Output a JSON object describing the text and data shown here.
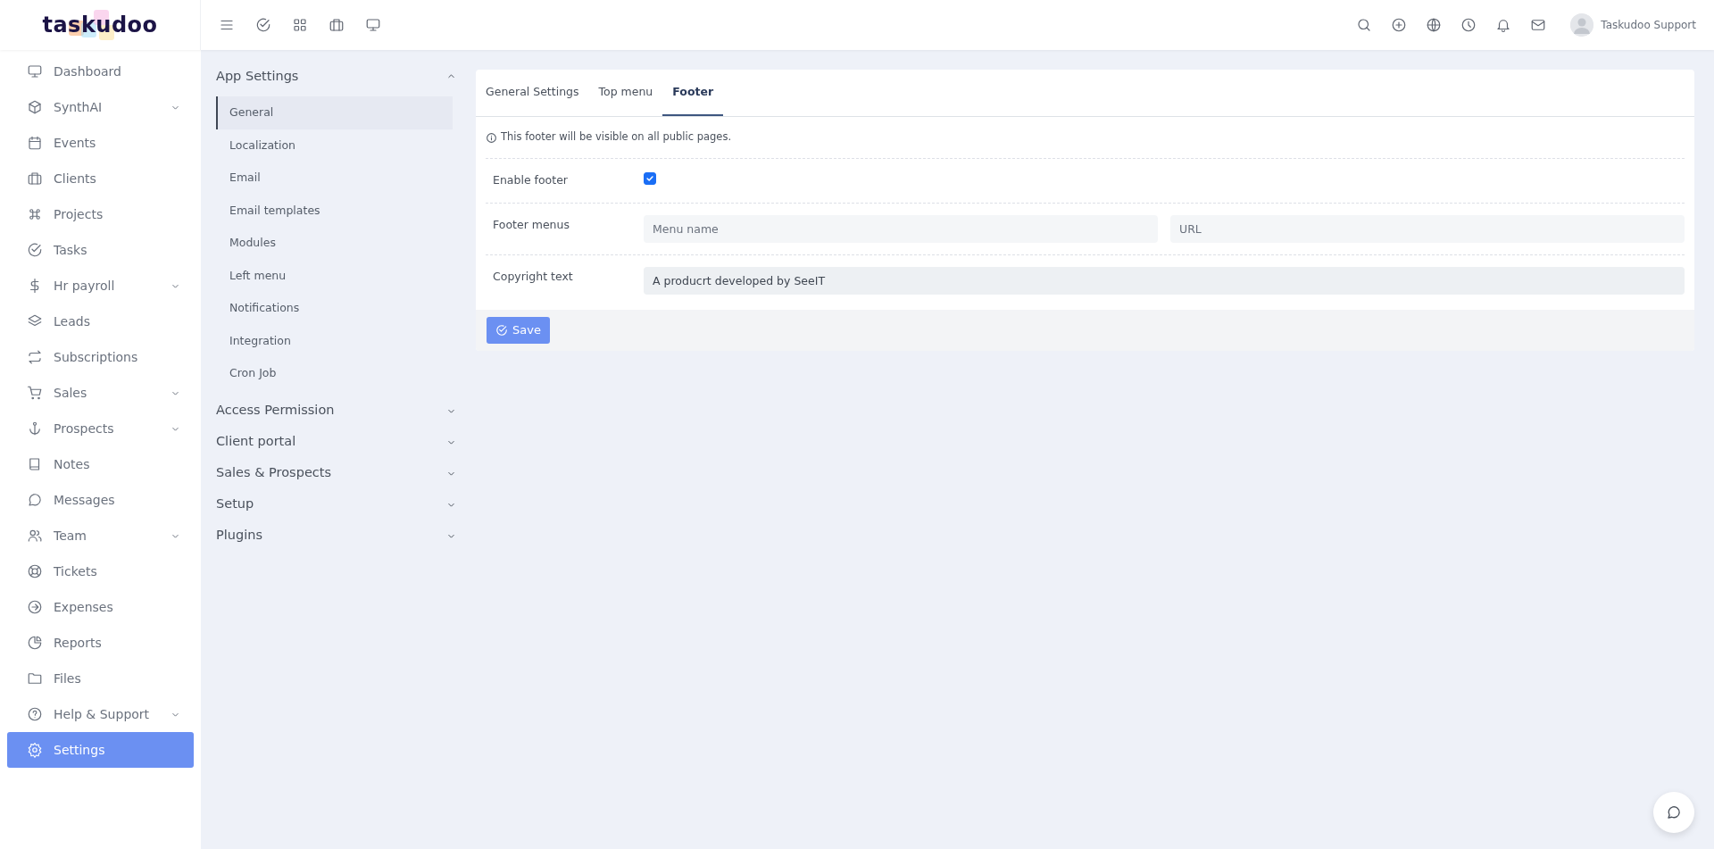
{
  "logo": {
    "text": "taskudoo"
  },
  "topbar": {
    "user": "Taskudoo Support"
  },
  "sidebar": {
    "items": [
      {
        "label": "Dashboard",
        "expandable": false,
        "selected": false
      },
      {
        "label": "SynthAI",
        "expandable": true,
        "selected": false
      },
      {
        "label": "Events",
        "expandable": false,
        "selected": false
      },
      {
        "label": "Clients",
        "expandable": false,
        "selected": false
      },
      {
        "label": "Projects",
        "expandable": false,
        "selected": false
      },
      {
        "label": "Tasks",
        "expandable": false,
        "selected": false
      },
      {
        "label": "Hr payroll",
        "expandable": true,
        "selected": false
      },
      {
        "label": "Leads",
        "expandable": false,
        "selected": false
      },
      {
        "label": "Subscriptions",
        "expandable": false,
        "selected": false
      },
      {
        "label": "Sales",
        "expandable": true,
        "selected": false
      },
      {
        "label": "Prospects",
        "expandable": true,
        "selected": false
      },
      {
        "label": "Notes",
        "expandable": false,
        "selected": false
      },
      {
        "label": "Messages",
        "expandable": false,
        "selected": false
      },
      {
        "label": "Team",
        "expandable": true,
        "selected": false
      },
      {
        "label": "Tickets",
        "expandable": false,
        "selected": false
      },
      {
        "label": "Expenses",
        "expandable": false,
        "selected": false
      },
      {
        "label": "Reports",
        "expandable": false,
        "selected": false
      },
      {
        "label": "Files",
        "expandable": false,
        "selected": false
      },
      {
        "label": "Help & Support",
        "expandable": true,
        "selected": false
      },
      {
        "label": "Settings",
        "expandable": false,
        "selected": true
      }
    ]
  },
  "settings_menu": {
    "sections": [
      {
        "title": "App Settings",
        "expanded": true,
        "items": [
          {
            "label": "General",
            "selected": true
          },
          {
            "label": "Localization",
            "selected": false
          },
          {
            "label": "Email",
            "selected": false
          },
          {
            "label": "Email templates",
            "selected": false
          },
          {
            "label": "Modules",
            "selected": false
          },
          {
            "label": "Left menu",
            "selected": false
          },
          {
            "label": "Notifications",
            "selected": false
          },
          {
            "label": "Integration",
            "selected": false
          },
          {
            "label": "Cron Job",
            "selected": false
          }
        ]
      },
      {
        "title": "Access Permission",
        "expanded": false
      },
      {
        "title": "Client portal",
        "expanded": false
      },
      {
        "title": "Sales & Prospects",
        "expanded": false
      },
      {
        "title": "Setup",
        "expanded": false
      },
      {
        "title": "Plugins",
        "expanded": false
      }
    ]
  },
  "tabs": [
    {
      "label": "General Settings",
      "selected": false
    },
    {
      "label": "Top menu",
      "selected": false
    },
    {
      "label": "Footer",
      "selected": true
    }
  ],
  "notice": "This footer will be visible on all public pages.",
  "form": {
    "rows": [
      {
        "kind": "checkbox",
        "label": "Enable footer",
        "checked": true
      },
      {
        "kind": "pair",
        "label": "Footer menus",
        "fields": [
          {
            "placeholder": "Menu name"
          },
          {
            "placeholder": "URL"
          }
        ]
      },
      {
        "kind": "text",
        "label": "Copyright text",
        "value": "A producrt developed by SeeIT",
        "focused": true
      }
    ]
  },
  "save_button": "Save"
}
